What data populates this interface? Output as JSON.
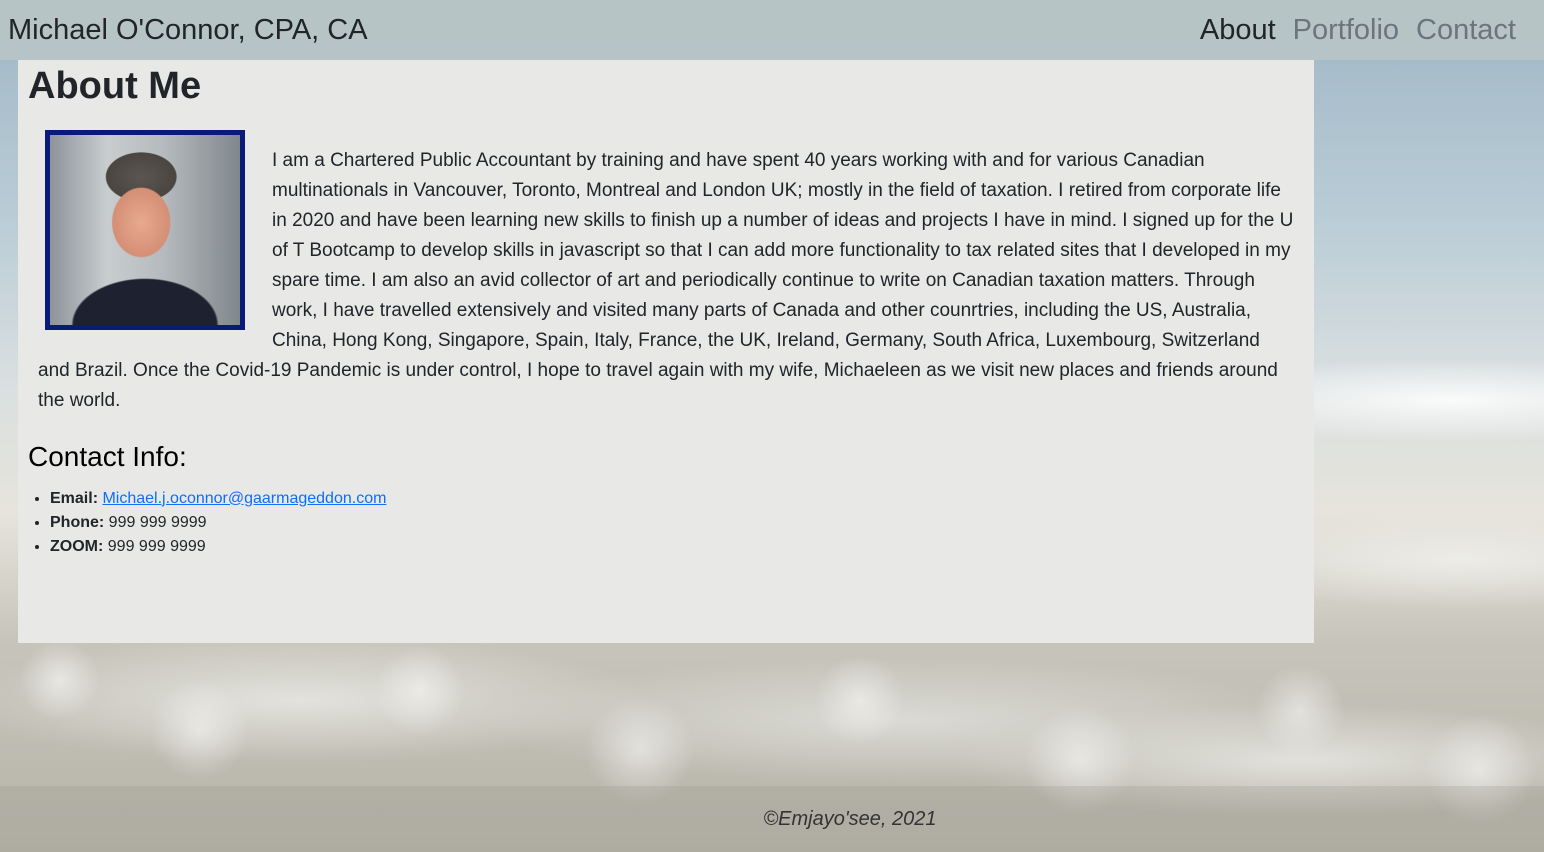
{
  "header": {
    "brand": "Michael O'Connor, CPA, CA",
    "nav": [
      {
        "label": "About",
        "active": true
      },
      {
        "label": "Portfolio",
        "active": false
      },
      {
        "label": "Contact",
        "active": false
      }
    ]
  },
  "main": {
    "title": "About Me",
    "bio": "I am a Chartered Public Accountant by training and have spent 40 years working with and for various Canadian multinationals in Vancouver, Toronto, Montreal and London UK; mostly in the field of taxation. I retired from corporate life in 2020 and have been learning new skills to finish up a number of ideas and projects I have in mind. I signed up for the U of T Bootcamp to develop skills in javascript so that I can add more functionality to tax related sites that I developed in my spare time. I am also an avid collector of art and periodically continue to write on Canadian taxation matters. Through work, I have travelled extensively and visited many parts of Canada and other counrtries, including the US, Australia, China, Hong Kong, Singapore, Spain, Italy, France, the UK, Ireland, Germany, South Africa, Luxembourg, Switzerland and Brazil. Once the Covid-19 Pandemic is under control, I hope to travel again with my wife, Michaeleen as we visit new places and friends around the world.",
    "contact": {
      "title": "Contact Info:",
      "email_label": "Email:",
      "email": "Michael.j.oconnor@gaarmageddon.com",
      "phone_label": "Phone:",
      "phone": "999 999 9999",
      "zoom_label": "ZOOM:",
      "zoom": "999 999 9999"
    }
  },
  "footer": {
    "text": "©Emjayo'see, 2021"
  },
  "colors": {
    "header_bg": "#b7c4c6",
    "panel_bg": "#e8e8e7",
    "portrait_border": "#0a1a7a",
    "link": "#0d6efd"
  }
}
